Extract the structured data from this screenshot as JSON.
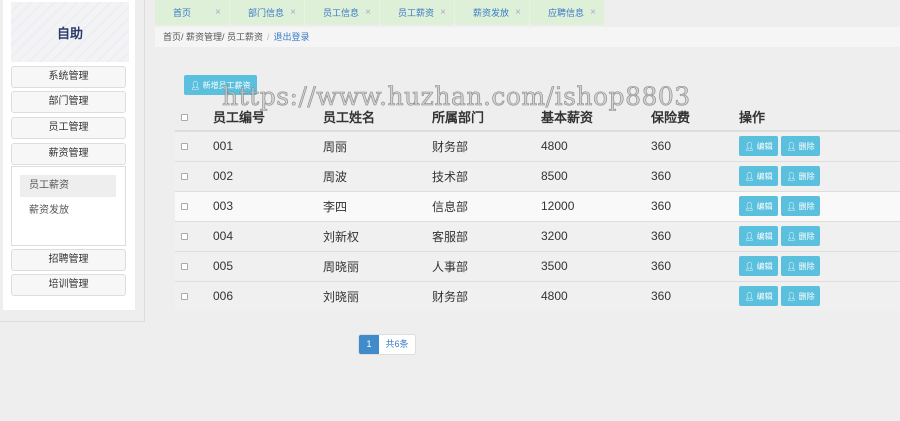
{
  "logo_text": "自助",
  "sidebar": {
    "menus": [
      "系统管理",
      "部门管理",
      "员工管理",
      "薪资管理",
      "招聘管理",
      "培训管理"
    ],
    "submenu": [
      "员工薪资",
      "薪资发放"
    ]
  },
  "tabs": [
    "首页",
    "部门信息",
    "员工信息",
    "员工薪资",
    "薪资发放",
    "应聘信息"
  ],
  "tab_close": "×",
  "breadcrumb": {
    "path": "首页/ 薪资管理/ 员工薪资",
    "sep": "/",
    "logout": "退出登录"
  },
  "add_button": "新增员工薪资",
  "table": {
    "headers": [
      "员工编号",
      "员工姓名",
      "所属部门",
      "基本薪资",
      "保险费",
      "操作"
    ],
    "rows": [
      [
        "001",
        "周丽",
        "财务部",
        "4800",
        "360"
      ],
      [
        "002",
        "周波",
        "技术部",
        "8500",
        "360"
      ],
      [
        "003",
        "李四",
        "信息部",
        "12000",
        "360"
      ],
      [
        "004",
        "刘新权",
        "客服部",
        "3200",
        "360"
      ],
      [
        "005",
        "周晓丽",
        "人事部",
        "3500",
        "360"
      ],
      [
        "006",
        "刘晓丽",
        "财务部",
        "4800",
        "360"
      ]
    ],
    "edit_label": "编辑",
    "delete_label": "删除"
  },
  "pager": {
    "current": "1",
    "total": "共6条"
  },
  "watermark": "https://www.huzhan.com/ishop8803"
}
